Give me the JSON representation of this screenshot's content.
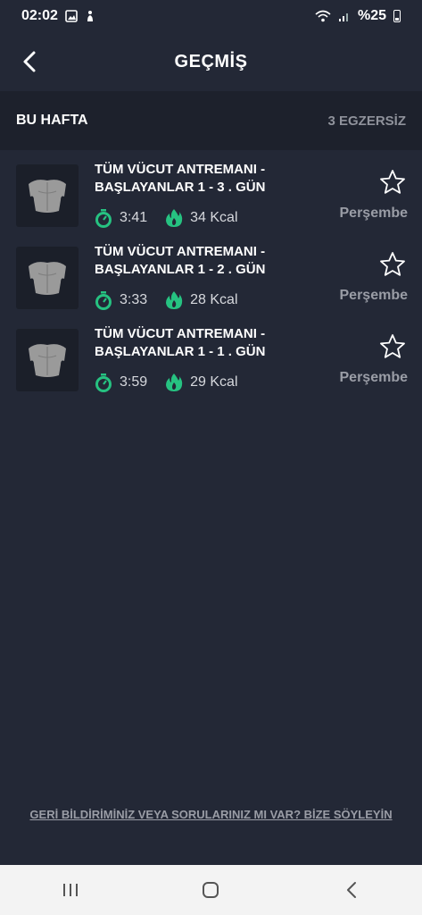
{
  "status": {
    "time": "02:02",
    "battery": "%25"
  },
  "header": {
    "title": "GEÇMİŞ"
  },
  "section": {
    "title": "BU HAFTA",
    "count": "3 EGZERSİZ"
  },
  "workouts": [
    {
      "title": "TÜM VÜCUT ANTREMANI - BAŞLAYANLAR 1 - 3 . GÜN",
      "duration": "3:41",
      "calories": "34 Kcal",
      "day": "Perşembe"
    },
    {
      "title": "TÜM VÜCUT ANTREMANI - BAŞLAYANLAR 1 - 2 . GÜN",
      "duration": "3:33",
      "calories": "28 Kcal",
      "day": "Perşembe"
    },
    {
      "title": "TÜM VÜCUT ANTREMANI - BAŞLAYANLAR 1 - 1 . GÜN",
      "duration": "3:59",
      "calories": "29 Kcal",
      "day": "Perşembe"
    }
  ],
  "footer": {
    "feedback": "GERİ BİLDİRİMİNİZ VEYA SORULARINIZ MI VAR? BİZE SÖYLEYİN"
  },
  "colors": {
    "background": "#232836",
    "accent": "#26c281",
    "section_bg": "#1d212c"
  },
  "icons": [
    "image-icon",
    "gesture-icon",
    "wifi-icon",
    "signal-icon",
    "battery-icon",
    "back-icon",
    "star-icon",
    "timer-icon",
    "flame-icon",
    "torso-icon",
    "recent-apps-icon",
    "home-icon",
    "nav-back-icon"
  ]
}
